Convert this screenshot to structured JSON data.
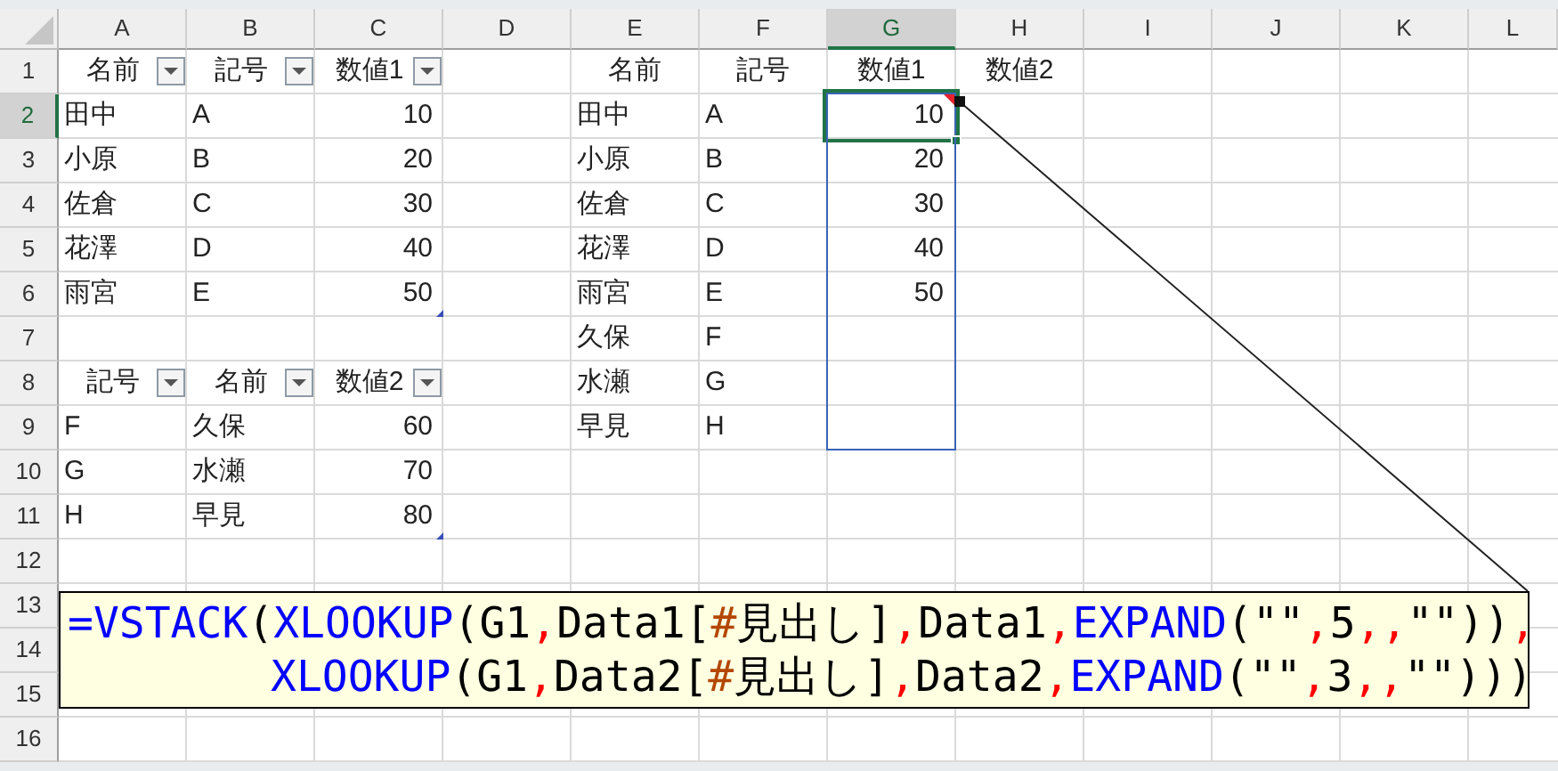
{
  "columns": [
    {
      "label": "A",
      "selected": false
    },
    {
      "label": "B",
      "selected": false
    },
    {
      "label": "C",
      "selected": false
    },
    {
      "label": "D",
      "selected": false
    },
    {
      "label": "E",
      "selected": false
    },
    {
      "label": "F",
      "selected": false
    },
    {
      "label": "G",
      "selected": true
    },
    {
      "label": "H",
      "selected": false
    },
    {
      "label": "I",
      "selected": false
    },
    {
      "label": "J",
      "selected": false
    },
    {
      "label": "K",
      "selected": false
    },
    {
      "label": "L",
      "selected": false
    }
  ],
  "rows": [
    {
      "header": "1",
      "selected": false,
      "cells": {
        "A": {
          "kind": "filter_header",
          "text": "名前"
        },
        "B": {
          "kind": "filter_header",
          "text": "記号"
        },
        "C": {
          "kind": "filter_header",
          "text": "数値1"
        },
        "E": {
          "kind": "header",
          "text": "名前"
        },
        "F": {
          "kind": "header",
          "text": "記号"
        },
        "G": {
          "kind": "header",
          "text": "数値1"
        },
        "H": {
          "kind": "header",
          "text": "数値2"
        }
      }
    },
    {
      "header": "2",
      "selected": true,
      "cells": {
        "A": {
          "kind": "text",
          "text": "田中"
        },
        "B": {
          "kind": "text",
          "text": "A"
        },
        "C": {
          "kind": "number",
          "text": "10"
        },
        "E": {
          "kind": "text",
          "text": "田中"
        },
        "F": {
          "kind": "text",
          "text": "A"
        },
        "G": {
          "kind": "number",
          "text": "10",
          "active": true,
          "comment": true,
          "spill": true
        }
      }
    },
    {
      "header": "3",
      "selected": false,
      "cells": {
        "A": {
          "kind": "text",
          "text": "小原"
        },
        "B": {
          "kind": "text",
          "text": "B"
        },
        "C": {
          "kind": "number",
          "text": "20"
        },
        "E": {
          "kind": "text",
          "text": "小原"
        },
        "F": {
          "kind": "text",
          "text": "B"
        },
        "G": {
          "kind": "number",
          "text": "20",
          "spill": true
        }
      }
    },
    {
      "header": "4",
      "selected": false,
      "cells": {
        "A": {
          "kind": "text",
          "text": "佐倉"
        },
        "B": {
          "kind": "text",
          "text": "C"
        },
        "C": {
          "kind": "number",
          "text": "30"
        },
        "E": {
          "kind": "text",
          "text": "佐倉"
        },
        "F": {
          "kind": "text",
          "text": "C"
        },
        "G": {
          "kind": "number",
          "text": "30",
          "spill": true
        }
      }
    },
    {
      "header": "5",
      "selected": false,
      "cells": {
        "A": {
          "kind": "text",
          "text": "花澤"
        },
        "B": {
          "kind": "text",
          "text": "D"
        },
        "C": {
          "kind": "number",
          "text": "40"
        },
        "E": {
          "kind": "text",
          "text": "花澤"
        },
        "F": {
          "kind": "text",
          "text": "D"
        },
        "G": {
          "kind": "number",
          "text": "40",
          "spill": true
        }
      }
    },
    {
      "header": "6",
      "selected": false,
      "cells": {
        "A": {
          "kind": "text",
          "text": "雨宮"
        },
        "B": {
          "kind": "text",
          "text": "E"
        },
        "C": {
          "kind": "number",
          "text": "50",
          "table_end": true
        },
        "E": {
          "kind": "text",
          "text": "雨宮"
        },
        "F": {
          "kind": "text",
          "text": "E"
        },
        "G": {
          "kind": "number",
          "text": "50",
          "spill": true
        }
      }
    },
    {
      "header": "7",
      "selected": false,
      "cells": {
        "E": {
          "kind": "text",
          "text": "久保"
        },
        "F": {
          "kind": "text",
          "text": "F"
        },
        "G": {
          "kind": "number",
          "spill": true
        }
      }
    },
    {
      "header": "8",
      "selected": false,
      "cells": {
        "A": {
          "kind": "filter_header",
          "text": "記号"
        },
        "B": {
          "kind": "filter_header",
          "text": "名前"
        },
        "C": {
          "kind": "filter_header",
          "text": "数値2"
        },
        "E": {
          "kind": "text",
          "text": "水瀬"
        },
        "F": {
          "kind": "text",
          "text": "G"
        },
        "G": {
          "kind": "number",
          "spill": true
        }
      }
    },
    {
      "header": "9",
      "selected": false,
      "cells": {
        "A": {
          "kind": "text",
          "text": "F"
        },
        "B": {
          "kind": "text",
          "text": "久保"
        },
        "C": {
          "kind": "number",
          "text": "60"
        },
        "E": {
          "kind": "text",
          "text": "早見"
        },
        "F": {
          "kind": "text",
          "text": "H"
        },
        "G": {
          "kind": "number",
          "spill": true
        }
      }
    },
    {
      "header": "10",
      "selected": false,
      "cells": {
        "A": {
          "kind": "text",
          "text": "G"
        },
        "B": {
          "kind": "text",
          "text": "水瀬"
        },
        "C": {
          "kind": "number",
          "text": "70"
        }
      }
    },
    {
      "header": "11",
      "selected": false,
      "cells": {
        "A": {
          "kind": "text",
          "text": "H"
        },
        "B": {
          "kind": "text",
          "text": "早見"
        },
        "C": {
          "kind": "number",
          "text": "80",
          "table_end": true
        }
      }
    },
    {
      "header": "12",
      "selected": false
    },
    {
      "header": "13",
      "selected": false
    },
    {
      "header": "14",
      "selected": false
    },
    {
      "header": "15",
      "selected": false
    },
    {
      "header": "16",
      "selected": false
    }
  ],
  "callout": {
    "lines": [
      {
        "continuation": false,
        "segments": [
          {
            "kind": "func",
            "text": "=VSTACK"
          },
          {
            "kind": "plain",
            "text": "("
          },
          {
            "kind": "func",
            "text": "XLOOKUP"
          },
          {
            "kind": "plain",
            "text": "(G1"
          },
          {
            "kind": "sep",
            "text": ","
          },
          {
            "kind": "plain",
            "text": "Data1["
          },
          {
            "kind": "tag",
            "text": "#"
          },
          {
            "kind": "plain",
            "text": "見出し]"
          },
          {
            "kind": "sep",
            "text": ","
          },
          {
            "kind": "plain",
            "text": "Data1"
          },
          {
            "kind": "sep",
            "text": ","
          },
          {
            "kind": "func",
            "text": "EXPAND"
          },
          {
            "kind": "plain",
            "text": "(\"\""
          },
          {
            "kind": "sep",
            "text": ","
          },
          {
            "kind": "plain",
            "text": "5"
          },
          {
            "kind": "sep",
            "text": ",,"
          },
          {
            "kind": "plain",
            "text": "\"\"))"
          },
          {
            "kind": "sep",
            "text": ","
          }
        ]
      },
      {
        "continuation": true,
        "segments": [
          {
            "kind": "func",
            "text": "XLOOKUP"
          },
          {
            "kind": "plain",
            "text": "(G1"
          },
          {
            "kind": "sep",
            "text": ","
          },
          {
            "kind": "plain",
            "text": "Data2["
          },
          {
            "kind": "tag",
            "text": "#"
          },
          {
            "kind": "plain",
            "text": "見出し]"
          },
          {
            "kind": "sep",
            "text": ","
          },
          {
            "kind": "plain",
            "text": "Data2"
          },
          {
            "kind": "sep",
            "text": ","
          },
          {
            "kind": "func",
            "text": "EXPAND"
          },
          {
            "kind": "plain",
            "text": "(\"\""
          },
          {
            "kind": "sep",
            "text": ","
          },
          {
            "kind": "plain",
            "text": "3"
          },
          {
            "kind": "sep",
            "text": ",,"
          },
          {
            "kind": "plain",
            "text": "\"\")))"
          }
        ]
      }
    ]
  }
}
